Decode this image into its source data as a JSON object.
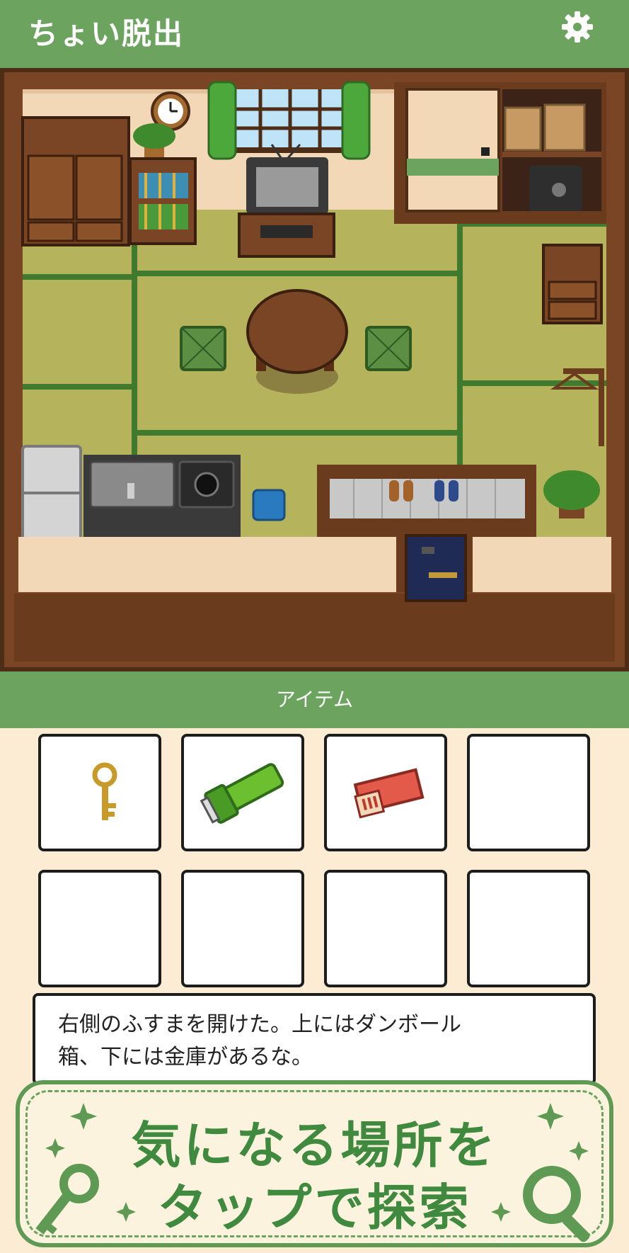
{
  "app": {
    "title": "ちょい脱出"
  },
  "settings": {
    "icon": "gear-icon"
  },
  "scene": {
    "objects": [
      "wall-clock",
      "window-with-curtains",
      "wardrobe",
      "bookshelf",
      "potted-plant",
      "crt-tv",
      "tv-stand",
      "fusuma-sliding-door",
      "cardboard-boxes",
      "safe",
      "bedside-drawer",
      "low-round-table",
      "floor-cushion-left",
      "floor-cushion-right",
      "coat-hanger",
      "refrigerator",
      "kitchen-sink",
      "stove",
      "blue-trash-bin",
      "shoe-entrance",
      "shoes",
      "potted-plant-corner",
      "front-door"
    ]
  },
  "items": {
    "section_label": "アイテム",
    "slots": [
      {
        "item": "key-icon"
      },
      {
        "item": "flashlight-icon"
      },
      {
        "item": "matchbox-icon"
      },
      {
        "item": ""
      },
      {
        "item": ""
      },
      {
        "item": ""
      },
      {
        "item": ""
      },
      {
        "item": ""
      }
    ]
  },
  "message": {
    "line1": "右側のふすまを開けた。上にはダンボール",
    "line2": "箱、下には金庫があるな。"
  },
  "banner": {
    "line1": "気になる場所を",
    "line2": "タップで探索",
    "icons": [
      "sparkle-icon",
      "key-icon",
      "magnifier-icon"
    ]
  },
  "colors": {
    "header_green": "#6ca45f",
    "panel_background": "#fbecd3",
    "banner_text": "#3f8a3f",
    "tatami": "#b6b35d",
    "wood": "#6b3b1e"
  }
}
